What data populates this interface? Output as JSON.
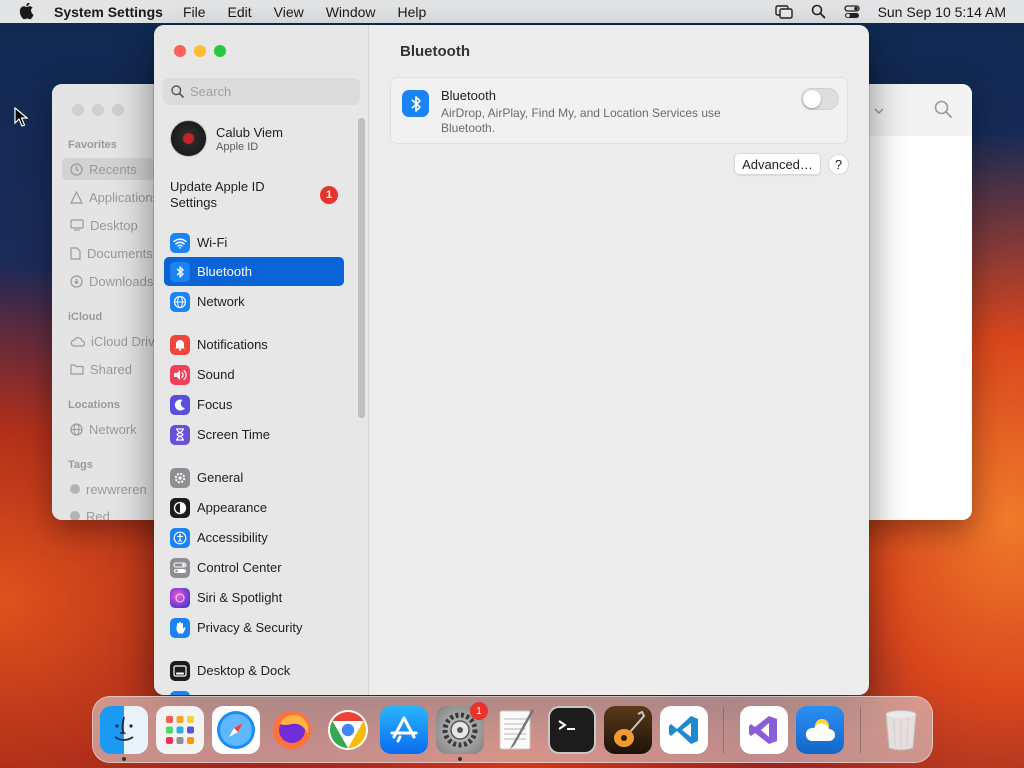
{
  "menubar": {
    "app_name": "System Settings",
    "menus": [
      "File",
      "Edit",
      "View",
      "Window",
      "Help"
    ],
    "datetime": "Sun Sep 10  5:14 AM"
  },
  "finder": {
    "sections": [
      "Favorites",
      "iCloud",
      "Locations",
      "Tags"
    ],
    "items": [
      "Recents",
      "Applications",
      "Desktop",
      "Documents",
      "Downloads",
      "iCloud Drive",
      "Shared",
      "Network",
      "rewwreren",
      "Red"
    ]
  },
  "settings": {
    "search_placeholder": "Search",
    "account": {
      "name": "Calub Viem",
      "subtitle": "Apple ID"
    },
    "update": {
      "label": "Update Apple ID Settings",
      "badge": "1"
    },
    "nav": [
      {
        "label": "Wi-Fi",
        "icon": "wifi-icon",
        "color": "#1a84f5"
      },
      {
        "label": "Bluetooth",
        "icon": "bluetooth-icon",
        "color": "#1a84f5"
      },
      {
        "label": "Network",
        "icon": "globe-icon",
        "color": "#1a84f5"
      },
      {
        "label": "Notifications",
        "icon": "bell-icon",
        "color": "#f0453a"
      },
      {
        "label": "Sound",
        "icon": "speaker-icon",
        "color": "#f0405a"
      },
      {
        "label": "Focus",
        "icon": "moon-icon",
        "color": "#5b4de0"
      },
      {
        "label": "Screen Time",
        "icon": "hourglass-icon",
        "color": "#6a4fd8"
      },
      {
        "label": "General",
        "icon": "gear-icon",
        "color": "#8e8e93"
      },
      {
        "label": "Appearance",
        "icon": "appearance-icon",
        "color": "#1c1c1e"
      },
      {
        "label": "Accessibility",
        "icon": "accessibility-icon",
        "color": "#1a84f5"
      },
      {
        "label": "Control Center",
        "icon": "control-center-icon",
        "color": "#8e8e93"
      },
      {
        "label": "Siri & Spotlight",
        "icon": "siri-icon",
        "color": "#7c3fd8"
      },
      {
        "label": "Privacy & Security",
        "icon": "hand-icon",
        "color": "#1a84f5"
      },
      {
        "label": "Desktop & Dock",
        "icon": "dock-icon",
        "color": "#1c1c1e"
      }
    ],
    "active": "Bluetooth",
    "content": {
      "title": "Bluetooth",
      "bt_name": "Bluetooth",
      "bt_desc": "AirDrop, AirPlay, Find My, and Location Services use Bluetooth.",
      "toggle_on": false,
      "advanced_label": "Advanced…",
      "help_label": "?"
    }
  },
  "dock": {
    "apps": [
      "Finder",
      "Launchpad",
      "Safari",
      "Firefox",
      "Chrome",
      "App Store",
      "System Settings",
      "TextEdit",
      "Terminal",
      "GarageBand",
      "Visual Studio Code",
      "Visual Studio",
      "Weather",
      "Trash"
    ],
    "settings_badge": "1"
  }
}
